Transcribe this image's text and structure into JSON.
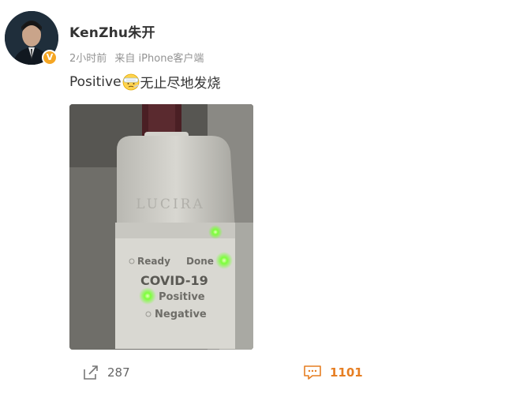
{
  "post": {
    "username": "KenZhu朱开",
    "verified_badge": "V",
    "time": "2小时前",
    "source": "来自 iPhone客户端",
    "text_before": "Positive",
    "emoji": "sick-face-emoji",
    "text_after": "无止尽地发烧",
    "photo_device_brand": "LUCIRA",
    "photo_labels": {
      "ready": "Ready",
      "done": "Done",
      "covid": "COVID-19",
      "positive": "Positive",
      "negative": "Negative"
    }
  },
  "actions": {
    "share_icon": "share-icon",
    "share_count": "287",
    "comment_icon": "comment-icon",
    "comment_count": "1101"
  },
  "colors": {
    "username": "#333333",
    "meta": "#939393",
    "comment_accent": "#e67e22",
    "verified_badge": "#f5a623",
    "indicator_green": "#7cff3a"
  }
}
